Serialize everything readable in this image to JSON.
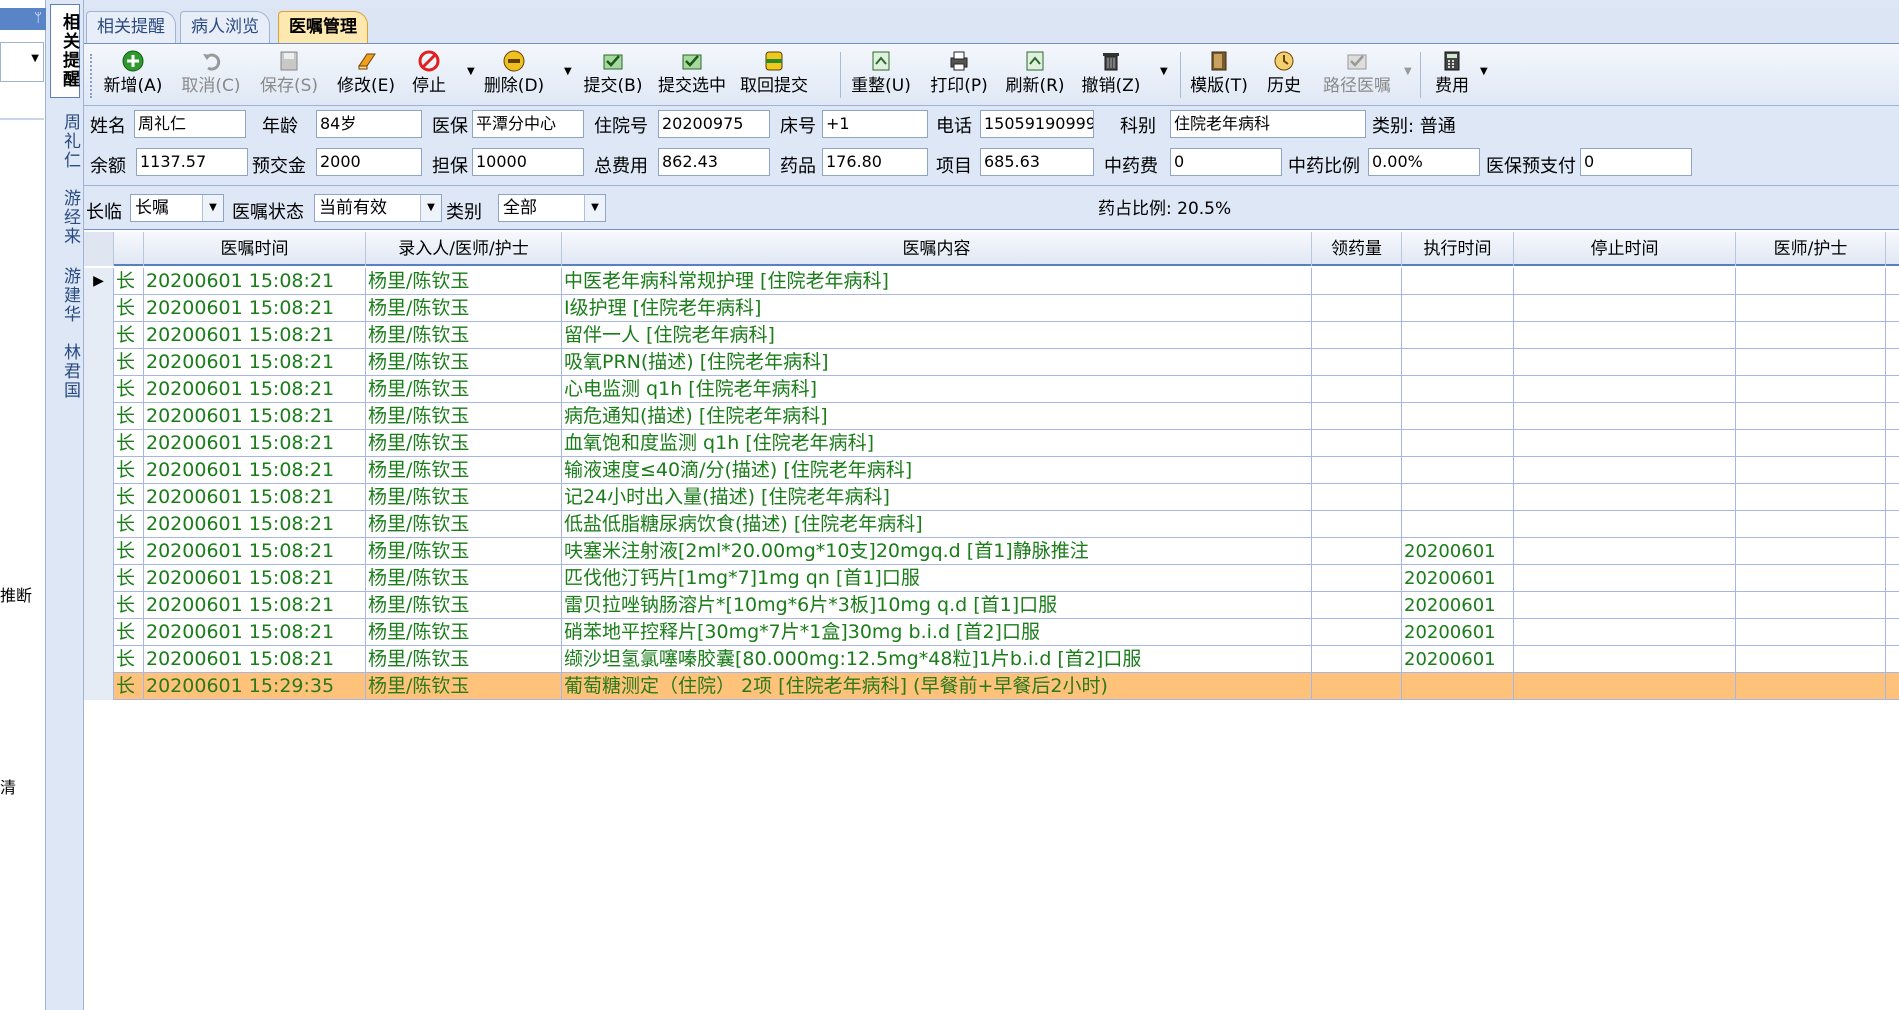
{
  "left_panel": {
    "pin_glyph": "ᛘ",
    "fragments": [
      "推断",
      "清"
    ]
  },
  "vertical_tabs": [
    "相关提醒",
    "周礼仁",
    "游经来",
    "游建华",
    "林君国"
  ],
  "tabs": [
    "相关提醒",
    "病人浏览",
    "医嘱管理"
  ],
  "toolbar": {
    "items": [
      {
        "label": "新增(A)",
        "icon": "add-icon",
        "enabled": true
      },
      {
        "label": "取消(C)",
        "icon": "undo-icon",
        "enabled": false
      },
      {
        "label": "保存(S)",
        "icon": "save-icon",
        "enabled": false
      },
      {
        "label": "修改(E)",
        "icon": "eraser-icon",
        "enabled": true
      },
      {
        "label": "停止",
        "icon": "stop-icon",
        "enabled": true
      },
      {
        "label": "删除(D)",
        "icon": "delete-icon",
        "enabled": true
      },
      {
        "label": "提交(B)",
        "icon": "submit-icon",
        "enabled": true
      },
      {
        "label": "提交选中",
        "icon": "submit-selected-icon",
        "enabled": true
      },
      {
        "label": "取回提交",
        "icon": "retrieve-icon",
        "enabled": true
      },
      {
        "label": "重整(U)",
        "icon": "reorganize-icon",
        "enabled": true
      },
      {
        "label": "打印(P)",
        "icon": "print-icon",
        "enabled": true
      },
      {
        "label": "刷新(R)",
        "icon": "refresh-icon",
        "enabled": true
      },
      {
        "label": "撤销(Z)",
        "icon": "trash-icon",
        "enabled": true
      },
      {
        "label": "模版(T)",
        "icon": "template-icon",
        "enabled": true
      },
      {
        "label": "历史",
        "icon": "history-icon",
        "enabled": true
      },
      {
        "label": "路径医嘱",
        "icon": "pathway-icon",
        "enabled": false
      },
      {
        "label": "费用",
        "icon": "calculator-icon",
        "enabled": true
      }
    ]
  },
  "patient": {
    "name_label": "姓名",
    "name": "周礼仁",
    "age_label": "年龄",
    "age": "84岁",
    "insurance_label": "医保",
    "insurance": "平潭分中心",
    "admission_label": "住院号",
    "admission_no": "20200975",
    "bed_label": "床号",
    "bed": "+1",
    "phone_label": "电话",
    "phone": "15059190999",
    "dept_label": "科别",
    "dept": "住院老年病科",
    "category_text": "类别: 普通",
    "balance_label": "余额",
    "balance": "1137.57",
    "deposit_label": "预交金",
    "deposit": "2000",
    "guarantee_label": "担保",
    "guarantee": "10000",
    "total_label": "总费用",
    "total": "862.43",
    "drug_label": "药品",
    "drug": "176.80",
    "item_label": "项目",
    "item": "685.63",
    "tcm_label": "中药费",
    "tcm": "0",
    "tcm_ratio_label": "中药比例",
    "tcm_ratio": "0.00%",
    "prepay_label": "医保预支付",
    "prepay": "0"
  },
  "filter": {
    "term_label": "长临",
    "term_value": "长嘱",
    "status_label": "医嘱状态",
    "status_value": "当前有效",
    "category_label": "类别",
    "category_value": "全部",
    "drug_ratio_text": "药占比例: 20.5%"
  },
  "grid": {
    "columns": [
      "医嘱时间",
      "录入人/医师/护士",
      "医嘱内容",
      "领药量",
      "执行时间",
      "停止时间",
      "医师/护士"
    ],
    "rows": [
      {
        "type": "长",
        "time": "20200601 15:08:21",
        "by": "杨里/陈钦玉",
        "content": "中医老年病科常规护理     [住院老年病科]",
        "exec": "",
        "current": true
      },
      {
        "type": "长",
        "time": "20200601 15:08:21",
        "by": "杨里/陈钦玉",
        "content": "Ⅰ级护理     [住院老年病科]",
        "exec": ""
      },
      {
        "type": "长",
        "time": "20200601 15:08:21",
        "by": "杨里/陈钦玉",
        "content": "留伴一人     [住院老年病科]",
        "exec": ""
      },
      {
        "type": "长",
        "time": "20200601 15:08:21",
        "by": "杨里/陈钦玉",
        "content": "吸氧PRN(描述)     [住院老年病科]",
        "exec": ""
      },
      {
        "type": "长",
        "time": "20200601 15:08:21",
        "by": "杨里/陈钦玉",
        "content": "心电监测  q1h  [住院老年病科]",
        "exec": ""
      },
      {
        "type": "长",
        "time": "20200601 15:08:21",
        "by": "杨里/陈钦玉",
        "content": "病危通知(描述)     [住院老年病科]",
        "exec": ""
      },
      {
        "type": "长",
        "time": "20200601 15:08:21",
        "by": "杨里/陈钦玉",
        "content": "血氧饱和度监测  q1h  [住院老年病科]",
        "exec": ""
      },
      {
        "type": "长",
        "time": "20200601 15:08:21",
        "by": "杨里/陈钦玉",
        "content": "输液速度≤40滴/分(描述)     [住院老年病科]",
        "exec": ""
      },
      {
        "type": "长",
        "time": "20200601 15:08:21",
        "by": "杨里/陈钦玉",
        "content": "记24小时出入量(描述)     [住院老年病科]",
        "exec": ""
      },
      {
        "type": "长",
        "time": "20200601 15:08:21",
        "by": "杨里/陈钦玉",
        "content": "低盐低脂糖尿病饮食(描述)     [住院老年病科]",
        "exec": ""
      },
      {
        "type": "长",
        "time": "20200601 15:08:21",
        "by": "杨里/陈钦玉",
        "content": "呋塞米注射液[2ml*20.00mg*10支]20mgq.d [首1]静脉推注",
        "exec": "20200601"
      },
      {
        "type": "长",
        "time": "20200601 15:08:21",
        "by": "杨里/陈钦玉",
        "content": "匹伐他汀钙片[1mg*7]1mg qn [首1]口服",
        "exec": "20200601"
      },
      {
        "type": "长",
        "time": "20200601 15:08:21",
        "by": "杨里/陈钦玉",
        "content": "雷贝拉唑钠肠溶片*[10mg*6片*3板]10mg q.d [首1]口服",
        "exec": "20200601"
      },
      {
        "type": "长",
        "time": "20200601 15:08:21",
        "by": "杨里/陈钦玉",
        "content": "硝苯地平控释片[30mg*7片*1盒]30mg b.i.d [首2]口服",
        "exec": "20200601"
      },
      {
        "type": "长",
        "time": "20200601 15:08:21",
        "by": "杨里/陈钦玉",
        "content": "缬沙坦氢氯噻嗪胶囊[80.000mg:12.5mg*48粒]1片b.i.d [首2]口服",
        "exec": "20200601"
      },
      {
        "type": "长",
        "time": "20200601 15:29:35",
        "by": "杨里/陈钦玉",
        "content": "葡萄糖测定（住院）   2项 [住院老年病科] (早餐前+早餐后2小时)",
        "exec": "",
        "selected": true
      }
    ]
  },
  "colors": {
    "text_green": "#1a7d1a",
    "selected_row": "#ffc27a",
    "active_tab": "#fde8b0",
    "panel_bg": "#dde7f5"
  }
}
